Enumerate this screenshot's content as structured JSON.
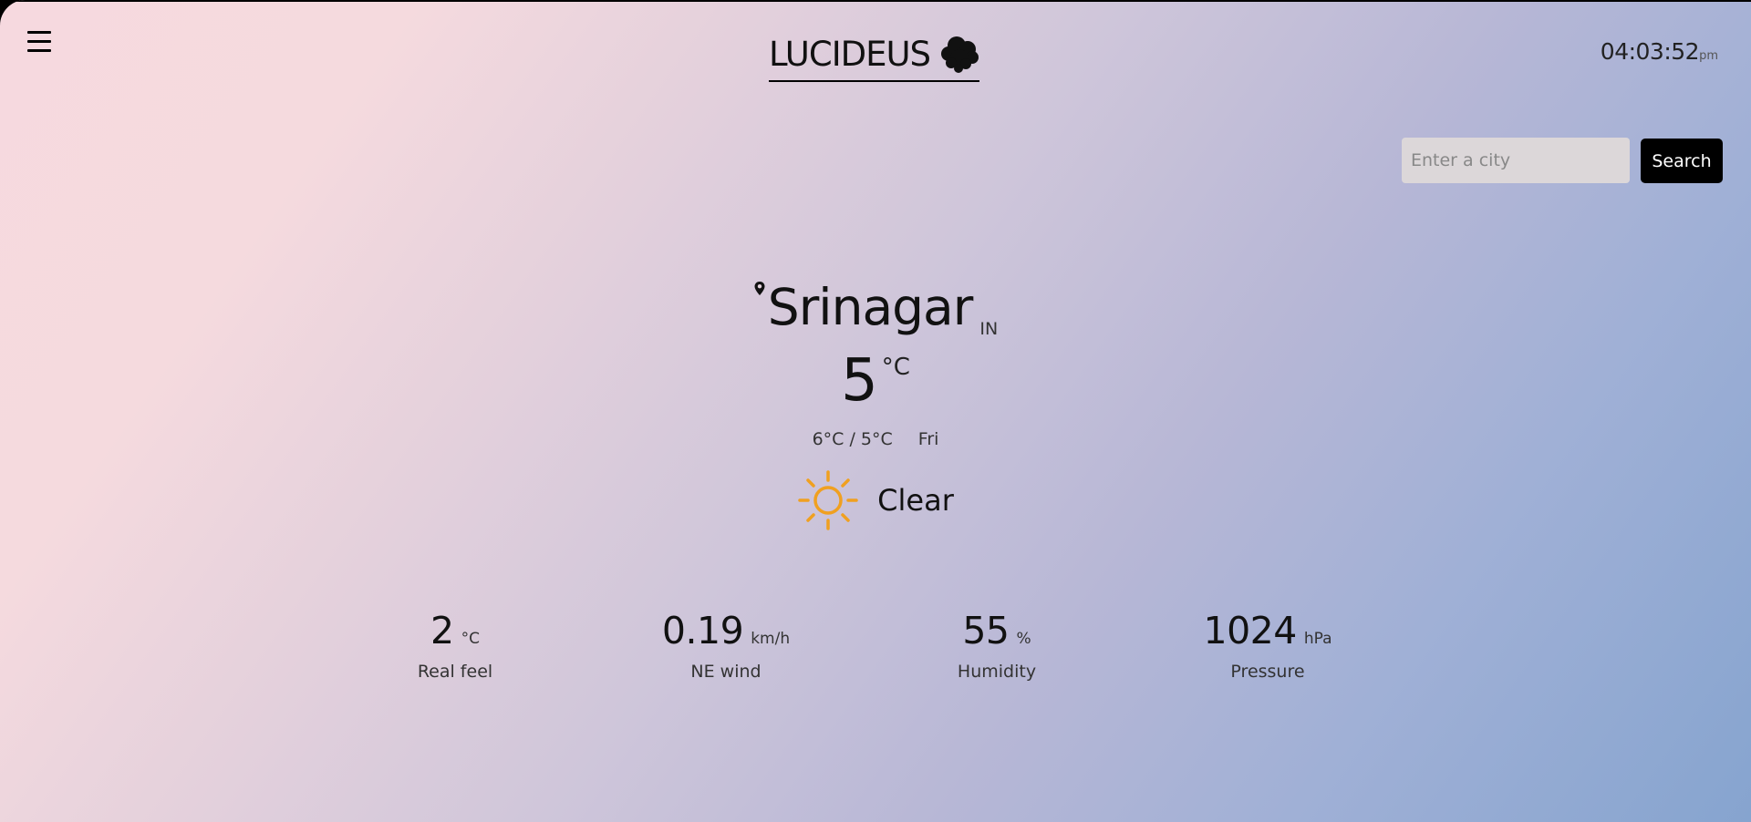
{
  "header": {
    "app_name": "LUCIDEUS",
    "logo_icon": "cloud-icon",
    "clock_time": "04:03:52",
    "clock_ampm": "pm"
  },
  "search": {
    "placeholder": "Enter a city",
    "value": "",
    "button_label": "Search"
  },
  "location": {
    "city": "Srinagar",
    "country": "IN"
  },
  "current": {
    "temperature": "5",
    "unit": "°C",
    "minmax": "6°C / 5°C",
    "day": "Fri",
    "condition": "Clear",
    "condition_icon": "sun-icon",
    "icon_color": "#f0a020"
  },
  "stats": [
    {
      "value": "2",
      "unit": "°C",
      "label": "Real feel"
    },
    {
      "value": "0.19",
      "unit": "km/h",
      "label": "NE wind"
    },
    {
      "value": "55",
      "unit": "%",
      "label": "Humidity"
    },
    {
      "value": "1024",
      "unit": "hPa",
      "label": "Pressure"
    }
  ]
}
